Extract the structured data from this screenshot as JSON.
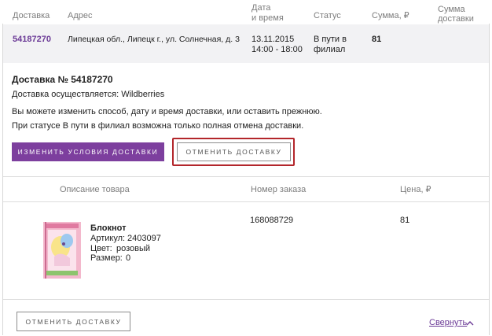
{
  "table_header": {
    "delivery": "Доставка",
    "address": "Адрес",
    "datetime_line1": "Дата",
    "datetime_line2": "и время",
    "status": "Статус",
    "amount": "Сумма, ₽",
    "delivery_amount_line1": "Сумма",
    "delivery_amount_line2": "доставки"
  },
  "order": {
    "id": "54187270",
    "address": "Липецкая обл., Липецк г., ул. Солнечная, д. 3",
    "date": "13.11.2015",
    "time": "14:00 - 18:00",
    "status_line1": "В пути в",
    "status_line2": "филиал",
    "amount": "81"
  },
  "details": {
    "title": "Доставка № 54187270",
    "carrier": "Доставка осуществляется: Wildberries",
    "info_line1": "Вы можете изменить способ, дату и время доставки, или оставить прежнюю.",
    "info_line2": "При статусе В пути в филиал возможна только полная отмена доставки.",
    "change_button": "ИЗМЕНИТЬ УСЛОВИЯ ДОСТАВКИ",
    "cancel_button": "ОТМЕНИТЬ ДОСТАВКУ"
  },
  "items_header": {
    "description": "Описание товара",
    "order_number": "Номер заказа",
    "price": "Цена, ₽"
  },
  "items": [
    {
      "name": "Блокнот",
      "article_label": "Артикул:",
      "article": "2403097",
      "color_label": "Цвет:",
      "color": "розовый",
      "size_label": "Размер:",
      "size": "0",
      "order_number": "168088729",
      "price": "81"
    }
  ],
  "footer": {
    "cancel_button": "ОТМЕНИТЬ ДОСТАВКУ",
    "collapse_link": "Свернуть",
    "collapse_icon": "chevron-up-icon"
  },
  "colors": {
    "accent": "#7d3f9e",
    "highlight": "#b3262b"
  }
}
